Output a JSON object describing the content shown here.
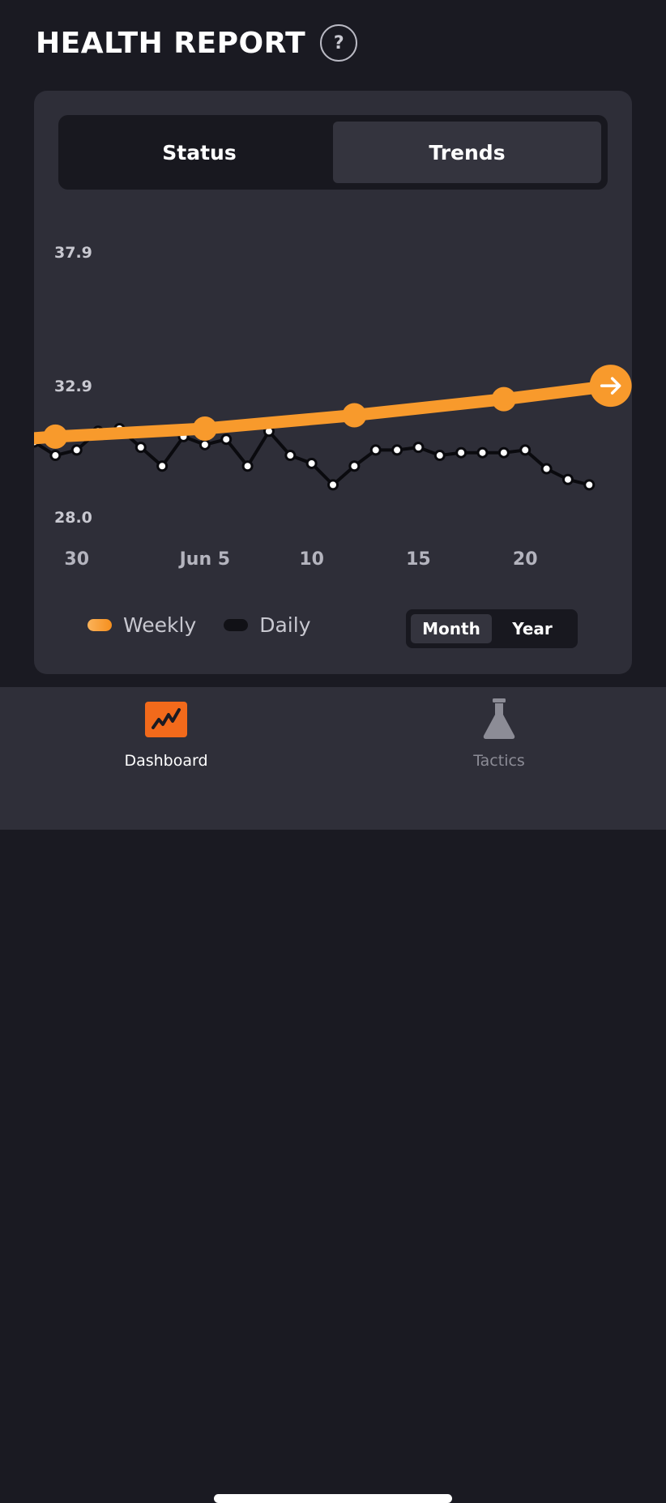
{
  "header": {
    "title": "HEALTH REPORT",
    "help_label": "?"
  },
  "tabs": {
    "status_label": "Status",
    "trends_label": "Trends",
    "selected": "Trends"
  },
  "legend": {
    "weekly_label": "Weekly",
    "daily_label": "Daily"
  },
  "range_toggle": {
    "month_label": "Month",
    "year_label": "Year",
    "selected": "Month"
  },
  "colors": {
    "accent_orange": "#f89a2c",
    "daily_line": "#0a0a0e",
    "card_bg": "#2e2e38",
    "page_bg": "#1a1a22"
  },
  "chart_data": {
    "type": "line",
    "yticks": [
      37.9,
      32.9,
      28.0
    ],
    "ylim": [
      28.0,
      37.9
    ],
    "xtick_labels": [
      "30",
      "Jun 5",
      "10",
      "15",
      "20"
    ],
    "xtick_day_index": [
      0,
      6,
      11,
      16,
      21
    ],
    "xlim": [
      -2,
      26
    ],
    "grid": false,
    "legend_position": "bottom-left",
    "series": [
      {
        "name": "Weekly",
        "color": "#f89a2c",
        "x": [
          -1,
          6,
          13,
          20,
          25
        ],
        "y": [
          31.0,
          31.3,
          31.8,
          32.4,
          32.9
        ]
      },
      {
        "name": "Daily",
        "color": "#0a0a0e",
        "x": [
          -2,
          -1,
          0,
          1,
          2,
          3,
          4,
          5,
          6,
          7,
          8,
          9,
          10,
          11,
          12,
          13,
          14,
          15,
          16,
          17,
          18,
          19,
          20,
          21,
          22,
          23,
          24
        ],
        "y": [
          30.8,
          30.3,
          30.5,
          31.2,
          31.3,
          30.6,
          29.9,
          31.0,
          30.7,
          30.9,
          29.9,
          31.2,
          30.3,
          30.0,
          29.2,
          29.9,
          30.5,
          30.5,
          30.6,
          30.3,
          30.4,
          30.4,
          30.4,
          30.5,
          29.8,
          29.4,
          29.2
        ]
      }
    ]
  },
  "tabbar": {
    "dashboard_label": "Dashboard",
    "tactics_label": "Tactics",
    "selected": "Dashboard"
  }
}
